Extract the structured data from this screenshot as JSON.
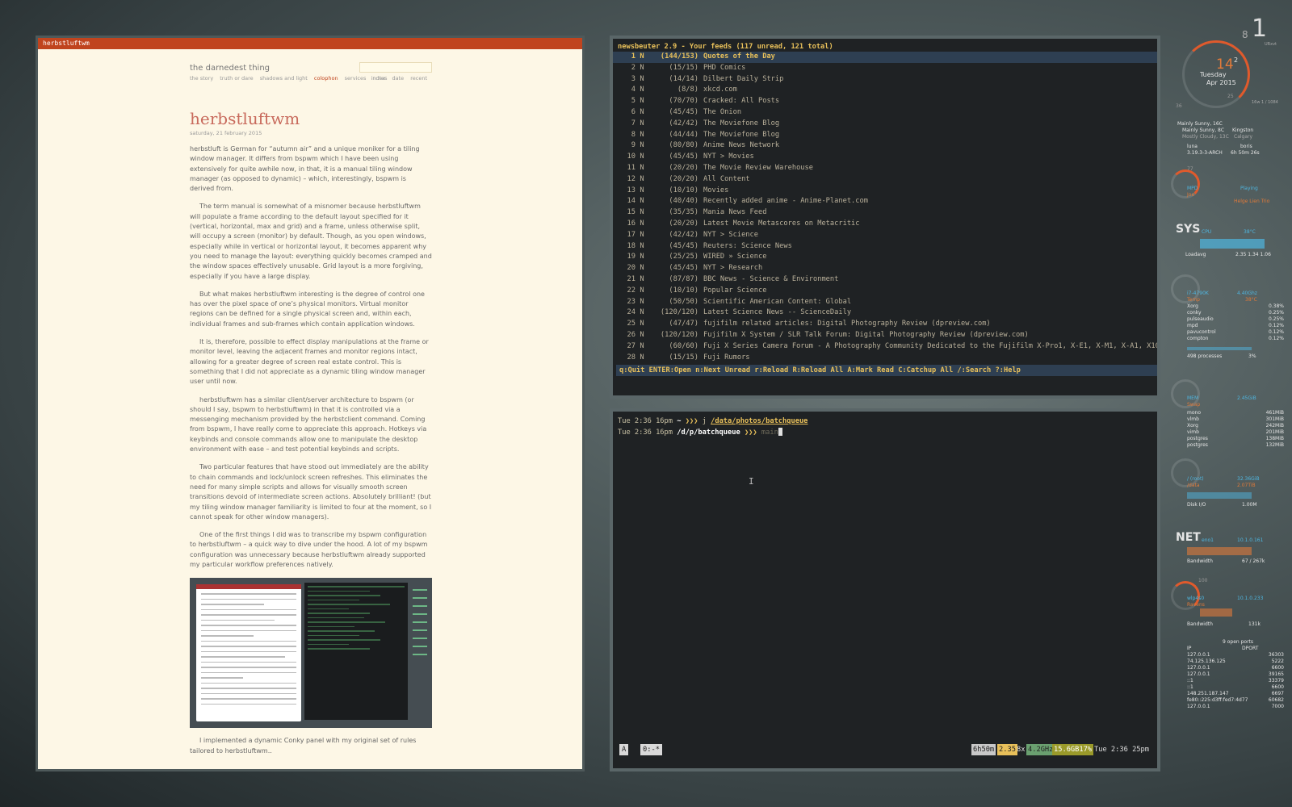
{
  "browser": {
    "title": "herbstluftwm",
    "site_title": "the darnedest thing",
    "nav_left": [
      "the story",
      "truth or dare",
      "shadows and light",
      "colophon",
      "services",
      "notes"
    ],
    "nav_active_index": 3,
    "nav_right": [
      "index",
      "date",
      "recent"
    ],
    "post_title": "herbstluftwm",
    "post_date": "saturday, 21 february 2015",
    "paragraphs": [
      "herbstluft is German for “autumn air” and a unique moniker for a tiling window manager. It differs from bspwm which I have been using extensively for quite awhile now, in that, it is a manual tiling window manager (as opposed to dynamic) – which, interestingly, bspwm is derived from.",
      "The term manual is somewhat of a misnomer because herbstluftwm will populate a frame according to the default layout specified for it (vertical, horizontal, max and grid) and a frame, unless otherwise split, will occupy a screen (monitor) by default. Though, as you open windows, especially while in vertical or horizontal layout, it becomes apparent why you need to manage the layout: everything quickly becomes cramped and the window spaces effectively unusable. Grid layout is a more forgiving, especially if you have a large display.",
      "But what makes herbstluftwm interesting is the degree of control one has over the pixel space of one’s physical monitors. Virtual monitor regions can be defined for a single physical screen and, within each, individual frames and sub-frames which contain application windows.",
      "It is, therefore, possible to effect display manipulations at the frame or monitor level, leaving the adjacent frames and monitor regions intact, allowing for a greater degree of screen real estate control. This is something that I did not appreciate as a dynamic tiling window manager user until now.",
      "herbstluftwm has a similar client/server architecture to bspwm (or should I say, bspwm to herbstluftwm) in that it is controlled via a messenging mechanism provided by the herbstclient command. Coming from bspwm, I have really come to appreciate this approach. Hotkeys via keybinds and console commands allow one to manipulate the desktop environment with ease – and test potential keybinds and scripts.",
      "Two particular features that have stood out immediately are the ability to chain commands and lock/unlock screen refreshes. This eliminates the need for many simple scripts and allows for visually smooth screen transitions devoid of intermediate screen actions. Absolutely brilliant! (but my tiling window manager familiarity is limited to four at the moment, so I cannot speak for other window managers).",
      "One of the first things I did was to transcribe my bspwm configuration to herbstluftwm – a quick way to dive under the hood. A lot of my bspwm configuration was unnecessary because herbstluftwm already supported my particular workflow preferences natively."
    ],
    "last_paragraph": "I implemented a dynamic Conky panel with my original set of rules tailored to herbstluftwm.."
  },
  "newsbeuter": {
    "header": "newsbeuter 2.9 - Your feeds (117 unread, 121 total)",
    "feeds": [
      {
        "n": "1",
        "flag": "N",
        "count": "(144/153)",
        "title": "Quotes of the Day"
      },
      {
        "n": "2",
        "flag": "N",
        "count": "(15/15)",
        "title": "PHD Comics"
      },
      {
        "n": "3",
        "flag": "N",
        "count": "(14/14)",
        "title": "Dilbert Daily Strip"
      },
      {
        "n": "4",
        "flag": "N",
        "count": "(8/8)",
        "title": "xkcd.com"
      },
      {
        "n": "5",
        "flag": "N",
        "count": "(70/70)",
        "title": "Cracked: All Posts"
      },
      {
        "n": "6",
        "flag": "N",
        "count": "(45/45)",
        "title": "The Onion"
      },
      {
        "n": "7",
        "flag": "N",
        "count": "(42/42)",
        "title": "The Moviefone Blog"
      },
      {
        "n": "8",
        "flag": "N",
        "count": "(44/44)",
        "title": "The Moviefone Blog"
      },
      {
        "n": "9",
        "flag": "N",
        "count": "(80/80)",
        "title": "Anime News Network"
      },
      {
        "n": "10",
        "flag": "N",
        "count": "(45/45)",
        "title": "NYT > Movies"
      },
      {
        "n": "11",
        "flag": "N",
        "count": "(20/20)",
        "title": "The Movie Review Warehouse"
      },
      {
        "n": "12",
        "flag": "N",
        "count": "(20/20)",
        "title": "All Content"
      },
      {
        "n": "13",
        "flag": "N",
        "count": "(10/10)",
        "title": "Movies"
      },
      {
        "n": "14",
        "flag": "N",
        "count": "(40/40)",
        "title": "Recently added anime - Anime-Planet.com"
      },
      {
        "n": "15",
        "flag": "N",
        "count": "(35/35)",
        "title": "Mania News Feed"
      },
      {
        "n": "16",
        "flag": "N",
        "count": "(20/20)",
        "title": "Latest Movie Metascores on Metacritic"
      },
      {
        "n": "17",
        "flag": "N",
        "count": "(42/42)",
        "title": "NYT > Science"
      },
      {
        "n": "18",
        "flag": "N",
        "count": "(45/45)",
        "title": "Reuters: Science News"
      },
      {
        "n": "19",
        "flag": "N",
        "count": "(25/25)",
        "title": "WIRED » Science"
      },
      {
        "n": "20",
        "flag": "N",
        "count": "(45/45)",
        "title": "NYT > Research"
      },
      {
        "n": "21",
        "flag": "N",
        "count": "(87/87)",
        "title": "BBC News - Science & Environment"
      },
      {
        "n": "22",
        "flag": "N",
        "count": "(10/10)",
        "title": "Popular Science"
      },
      {
        "n": "23",
        "flag": "N",
        "count": "(50/50)",
        "title": "Scientific American Content: Global"
      },
      {
        "n": "24",
        "flag": "N",
        "count": "(120/120)",
        "title": "Latest Science News -- ScienceDaily"
      },
      {
        "n": "25",
        "flag": "N",
        "count": "(47/47)",
        "title": "fujifilm related articles: Digital Photography Review (dpreview.com)"
      },
      {
        "n": "26",
        "flag": "N",
        "count": "(120/120)",
        "title": "Fujifilm X System / SLR Talk Forum: Digital Photography Review (dpreview.com)"
      },
      {
        "n": "27",
        "flag": "N",
        "count": "(60/60)",
        "title": "Fuji X Series Camera Forum - A Photography Community Dedicated to the Fujifilm X-Pro1, X-E1, X-M1, X-A1, X100S, X1"
      },
      {
        "n": "28",
        "flag": "N",
        "count": "(15/15)",
        "title": "Fuji Rumors"
      }
    ],
    "footer": "q:Quit ENTER:Open n:Next Unread r:Reload R:Reload All A:Mark Read C:Catchup All /:Search ?:Help"
  },
  "shell": {
    "line1": {
      "ts": "Tue 2:36 16pm",
      "cwd": "~",
      "arrow": "❯❯❯",
      "cmd": "j",
      "arg": "/data/photos/batchqueue"
    },
    "line2": {
      "ts": "Tue 2:36 16pm",
      "cwd": "/d/p/batchqueue",
      "arrow": "❯❯❯",
      "typed": "main"
    },
    "tmux": {
      "session": "A",
      "window": "0:-*",
      "uptime": "6h50m",
      "load": "2.35",
      "cpu_count": "8x",
      "cpu_freq": "4.2GHz",
      "mem": "15.6GB17%",
      "clock": "Tue 2:36 25pm"
    }
  },
  "conky": {
    "workspace_prev": "8",
    "workspace_current": "1",
    "workspace_label": "URxvt",
    "day": "14",
    "day_sup": "2",
    "weekday": "Tuesday",
    "month_year": "Apr 2015",
    "ring_25": "25",
    "ring_36": "36",
    "uptime_small": "16w 1 / 1084",
    "weather": [
      "Mainly Sunny, 16C",
      "Mainly Sunny, 8C",
      "Mostly Cloudy, 13C"
    ],
    "weather_cities": [
      "Kingston",
      "Calgary"
    ],
    "host": "luna",
    "kernel": "3.19.3-3-ARCH",
    "user": "boris",
    "uptime": "6h 50m 26s",
    "mpd_label": "MPD",
    "mpd_state": "Playing",
    "mpd_user": "Joe",
    "mpd_artist": "Helge Lien Trio",
    "mpd_vol": "77",
    "sys_label": "SYS",
    "cpu_label": "CPU",
    "cpu_temp": "38°C",
    "loadavg_label": "Loadavg",
    "loadavg": "2.35  1.34  1.06",
    "cpu_model": "i7-4790K",
    "cpu_ghz": "4.40Ghz",
    "temp_label": "Temp",
    "temp_val": "38°C",
    "procs": [
      [
        "Xorg",
        "0.38%"
      ],
      [
        "conky",
        "0.25%"
      ],
      [
        "pulseaudio",
        "0.25%"
      ],
      [
        "mpd",
        "0.12%"
      ],
      [
        "pavucontrol",
        "0.12%"
      ],
      [
        "compton",
        "0.12%"
      ]
    ],
    "processes": "498 processes",
    "proc_pct": "3%",
    "mem_label": "MEM",
    "mem_val": "2.45GiB",
    "swap_label": "Swap",
    "memprocs": [
      [
        "mono",
        "461MiB"
      ],
      [
        "vlmb",
        "301MiB"
      ],
      [
        "Xorg",
        "242MiB"
      ],
      [
        "vimb",
        "201MiB"
      ],
      [
        "postgres",
        "138MiB"
      ],
      [
        "postgres",
        "132MiB"
      ]
    ],
    "disk_root": "/ (root)",
    "disk_root_val": "32.36GiB",
    "disk_data": "/data",
    "disk_data_val": "2.07TiB",
    "diskio_label": "Disk I/O",
    "diskio_val": "1.00M",
    "net_label": "NET",
    "iface1": "eno1",
    "ip1": "10.1.0.161",
    "bandwidth_label": "Bandwidth",
    "bw1": "67 / 267k",
    "iface2": "wlp4s0",
    "ip2": "10.1.0.233",
    "wifi_name": "Ravens",
    "wifi_q": "100",
    "bw2": "131k",
    "open_ports": "9 open ports",
    "ports_header": [
      "IP",
      "DPORT"
    ],
    "ports": [
      [
        "127.0.0.1",
        "36303"
      ],
      [
        "74.125.136.125",
        "5222"
      ],
      [
        "127.0.0.1",
        "6600"
      ],
      [
        "127.0.0.1",
        "39165"
      ],
      [
        "::1",
        "33379"
      ],
      [
        "::1",
        "6600"
      ],
      [
        "148.251.187.147",
        "6697"
      ],
      [
        "fe80::225:d3ff:fed7:4d77",
        "60682"
      ],
      [
        "127.0.0.1",
        "7000"
      ]
    ]
  }
}
